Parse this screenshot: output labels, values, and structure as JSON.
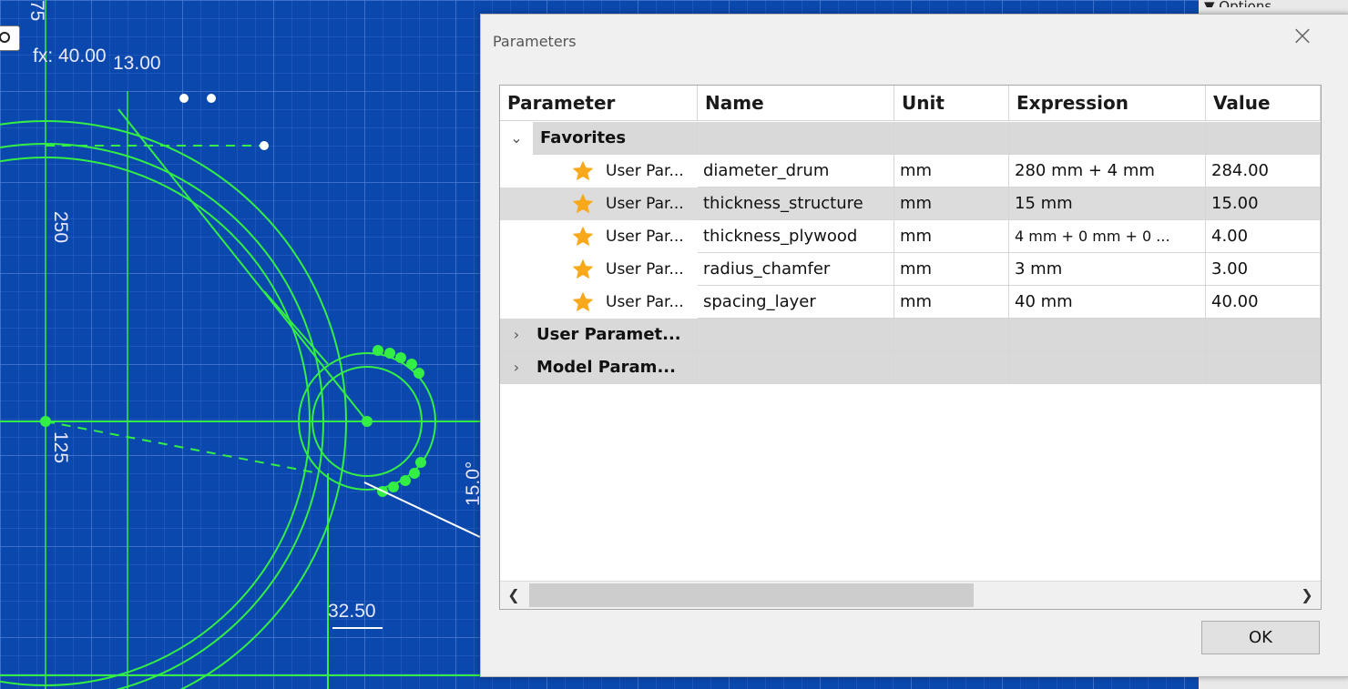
{
  "canvas": {
    "background": "#0b48ad",
    "grid_color": "#3c6ec8",
    "sketch_color": "#33ee44",
    "dimension_labels": [
      "75",
      "fx: 40.00",
      "13.00",
      "250",
      "125",
      "15.0°",
      "32.50"
    ]
  },
  "side_panel": {
    "options_label": "▼ Options"
  },
  "dialog": {
    "title": "Parameters",
    "close_icon": "close-icon",
    "columns": [
      "Parameter",
      "Name",
      "Unit",
      "Expression",
      "Value"
    ],
    "groups": [
      {
        "label": "Favorites",
        "expanded": true,
        "rows": [
          {
            "parameter": "User Par...",
            "name": "diameter_drum",
            "unit": "mm",
            "expression": "280 mm + 4 mm",
            "value": "284.00",
            "selected": false
          },
          {
            "parameter": "User Par...",
            "name": "thickness_structure",
            "unit": "mm",
            "expression": "15 mm",
            "value": "15.00",
            "selected": true
          },
          {
            "parameter": "User Par...",
            "name": "thickness_plywood",
            "unit": "mm",
            "expression": "4 mm + 0 mm + 0 ...",
            "value": "4.00",
            "selected": false
          },
          {
            "parameter": "User Par...",
            "name": "radius_chamfer",
            "unit": "mm",
            "expression": "3 mm",
            "value": "3.00",
            "selected": false
          },
          {
            "parameter": "User Par...",
            "name": "spacing_layer",
            "unit": "mm",
            "expression": "40 mm",
            "value": "40.00",
            "selected": false
          }
        ]
      },
      {
        "label": "User Paramet...",
        "expanded": false,
        "rows": []
      },
      {
        "label": "Model Param...",
        "expanded": false,
        "rows": []
      }
    ],
    "ok_label": "OK",
    "star_color": "#f7a81b",
    "selected_row_color": "#dcdcdc"
  }
}
